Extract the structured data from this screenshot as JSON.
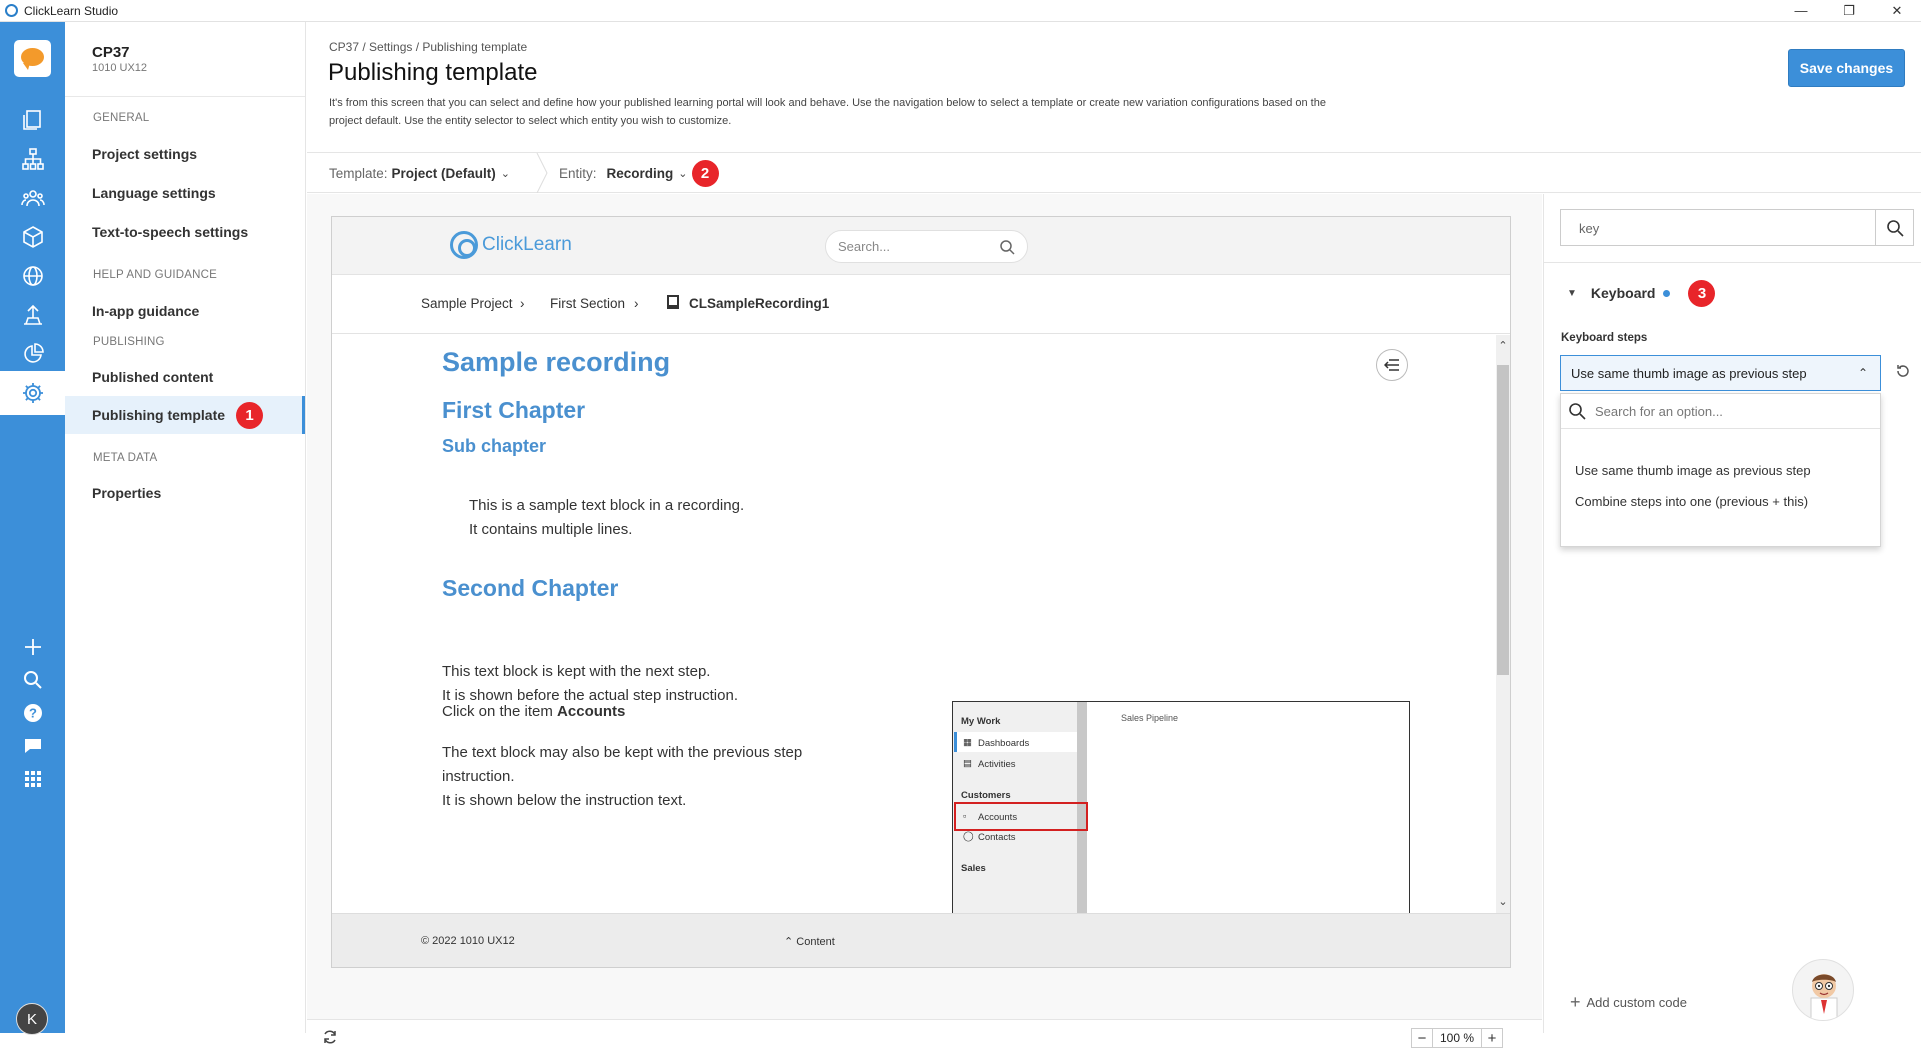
{
  "window": {
    "title": "ClickLearn Studio",
    "controls": [
      "—",
      "❐",
      "✕"
    ]
  },
  "rail": {
    "avatar_letter": "K"
  },
  "nav": {
    "project_name": "CP37",
    "project_sub": "1010 UX12",
    "sections": {
      "general": "GENERAL",
      "help": "HELP AND GUIDANCE",
      "publishing": "PUBLISHING",
      "meta": "META DATA"
    },
    "items": {
      "project_settings": "Project settings",
      "language_settings": "Language settings",
      "tts_settings": "Text-to-speech settings",
      "inapp": "In-app guidance",
      "published_content": "Published content",
      "publishing_template": "Publishing template",
      "properties": "Properties"
    }
  },
  "callouts": {
    "one": "1",
    "two": "2",
    "three": "3"
  },
  "header": {
    "breadcrumb": "CP37 / Settings / Publishing template",
    "title": "Publishing template",
    "description": "It's from this screen that you can select and define how your published learning portal will look and behave. Use the navigation below to select a template or create new variation configurations based on the project default. Use the entity selector to select which entity you wish to customize.",
    "save_label": "Save changes"
  },
  "toolbar": {
    "template_label": "Template:",
    "template_value": "Project (Default)",
    "entity_label": "Entity:",
    "entity_value": "Recording"
  },
  "preview": {
    "logo_text": "ClickLearn",
    "search_placeholder": "Search...",
    "crumbs": [
      "Sample Project",
      "First Section",
      "CLSampleRecording1"
    ],
    "h1": "Sample recording",
    "chapter1": "First Chapter",
    "subchapter": "Sub chapter",
    "block1_line1": "This is a sample text block in a recording.",
    "block1_line2": "It contains multiple lines.",
    "chapter2": "Second Chapter",
    "block2_line1": "This text block is kept with the next step.",
    "block2_line2": "It is shown before the actual step instruction.",
    "click_prefix": "Click on the item ",
    "click_target": "Accounts",
    "block3_line1": "The text block may also be kept with the previous step",
    "block3_line2": "instruction.",
    "block3_line3": "It is shown below the instruction text.",
    "footer_copyright": "© 2022 1010 UX12",
    "footer_content": "Content",
    "screenshot": {
      "my_work": "My Work",
      "dashboards": "Dashboards",
      "activities": "Activities",
      "customers": "Customers",
      "accounts": "Accounts",
      "contacts": "Contacts",
      "sales": "Sales",
      "pipeline": "Sales Pipeline"
    }
  },
  "props": {
    "search_value": "key",
    "group": "Keyboard",
    "steps_label": "Keyboard steps",
    "selected": "Use same thumb image as previous step",
    "dd_placeholder": "Search for an option...",
    "options": [
      "Use same thumb image as previous step",
      "Combine steps into one (previous + this)"
    ],
    "add_custom_code": "Add custom code"
  },
  "status": {
    "zoom": "100 %",
    "zoom_minus": "−",
    "zoom_plus": "+"
  },
  "colors": {
    "accent": "#3c8fd9",
    "callout": "#e8252a",
    "heading": "#4a90cf"
  }
}
